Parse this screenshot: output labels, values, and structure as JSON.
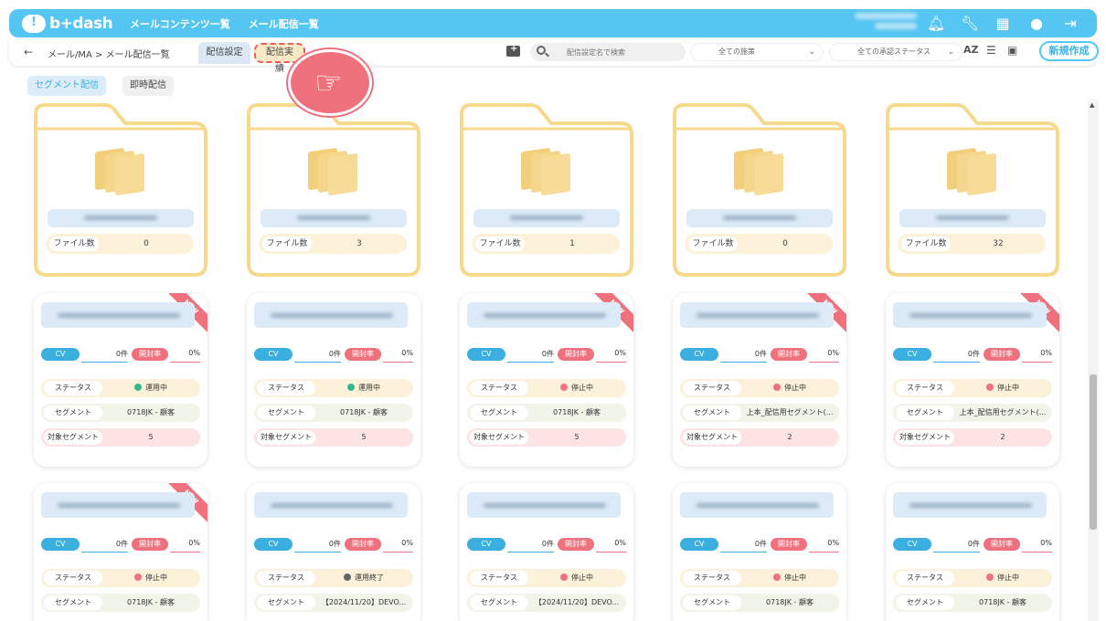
{
  "header": {
    "logo_text": "b+dash",
    "nav": [
      "メールコンテンツ一覧",
      "メール配信一覧"
    ],
    "icons": [
      "bell-icon",
      "wrench-icon",
      "grid-icon",
      "chat-icon",
      "logout-icon"
    ]
  },
  "toolbar": {
    "breadcrumb": "メール/MA > メール配信一覧",
    "tab_settings": "配信設定",
    "tab_results": "配信実績",
    "search_placeholder": "配信設定名で検索",
    "select_measure": "全ての施策",
    "select_approval": "全ての承認ステータス",
    "sort_icon": "AZ",
    "new_button": "新規作成"
  },
  "filters": {
    "segment": "セグメント配信",
    "instant": "即時配信"
  },
  "labels": {
    "file_count": "ファイル数",
    "cv": "CV",
    "open_rate": "開封率",
    "status": "ステータス",
    "segment": "セグメント",
    "target_segment": "対象セグメント",
    "new_ribbon": "NEW"
  },
  "folders": [
    {
      "count": "0"
    },
    {
      "count": "3"
    },
    {
      "count": "1"
    },
    {
      "count": "0"
    },
    {
      "count": "32"
    }
  ],
  "cards_row1": [
    {
      "new": true,
      "cv": "0件",
      "open": "0%",
      "status": "運用中",
      "status_type": "run",
      "segment": "0718JK - 顧客",
      "target": "5"
    },
    {
      "new": false,
      "cv": "0件",
      "open": "0%",
      "status": "運用中",
      "status_type": "run",
      "segment": "0718JK - 顧客",
      "target": "5"
    },
    {
      "new": true,
      "cv": "0件",
      "open": "0%",
      "status": "停止中",
      "status_type": "stop",
      "segment": "0718JK - 顧客",
      "target": "5"
    },
    {
      "new": true,
      "cv": "0件",
      "open": "0%",
      "status": "停止中",
      "status_type": "stop",
      "segment": "上本_配信用セグメント(...",
      "target": "2"
    },
    {
      "new": true,
      "cv": "0件",
      "open": "0%",
      "status": "停止中",
      "status_type": "stop",
      "segment": "上本_配信用セグメント(...",
      "target": "2"
    }
  ],
  "cards_row2": [
    {
      "new": true,
      "cv": "0件",
      "open": "0%",
      "status": "停止中",
      "status_type": "stop",
      "segment": "0718JK - 顧客"
    },
    {
      "new": false,
      "cv": "0件",
      "open": "0%",
      "status": "運用終了",
      "status_type": "end",
      "segment": "【2024/11/20】DEVO..."
    },
    {
      "new": false,
      "cv": "0件",
      "open": "0%",
      "status": "停止中",
      "status_type": "stop",
      "segment": "【2024/11/20】DEVO..."
    },
    {
      "new": false,
      "cv": "0件",
      "open": "0%",
      "status": "停止中",
      "status_type": "stop",
      "segment": "0718JK - 顧客"
    },
    {
      "new": false,
      "cv": "0件",
      "open": "0%",
      "status": "停止中",
      "status_type": "stop",
      "segment": "0718JK - 顧客"
    }
  ],
  "colors": {
    "brand": "#55c5f2",
    "accent_red": "#f0717e",
    "folder": "#f6d98a"
  }
}
